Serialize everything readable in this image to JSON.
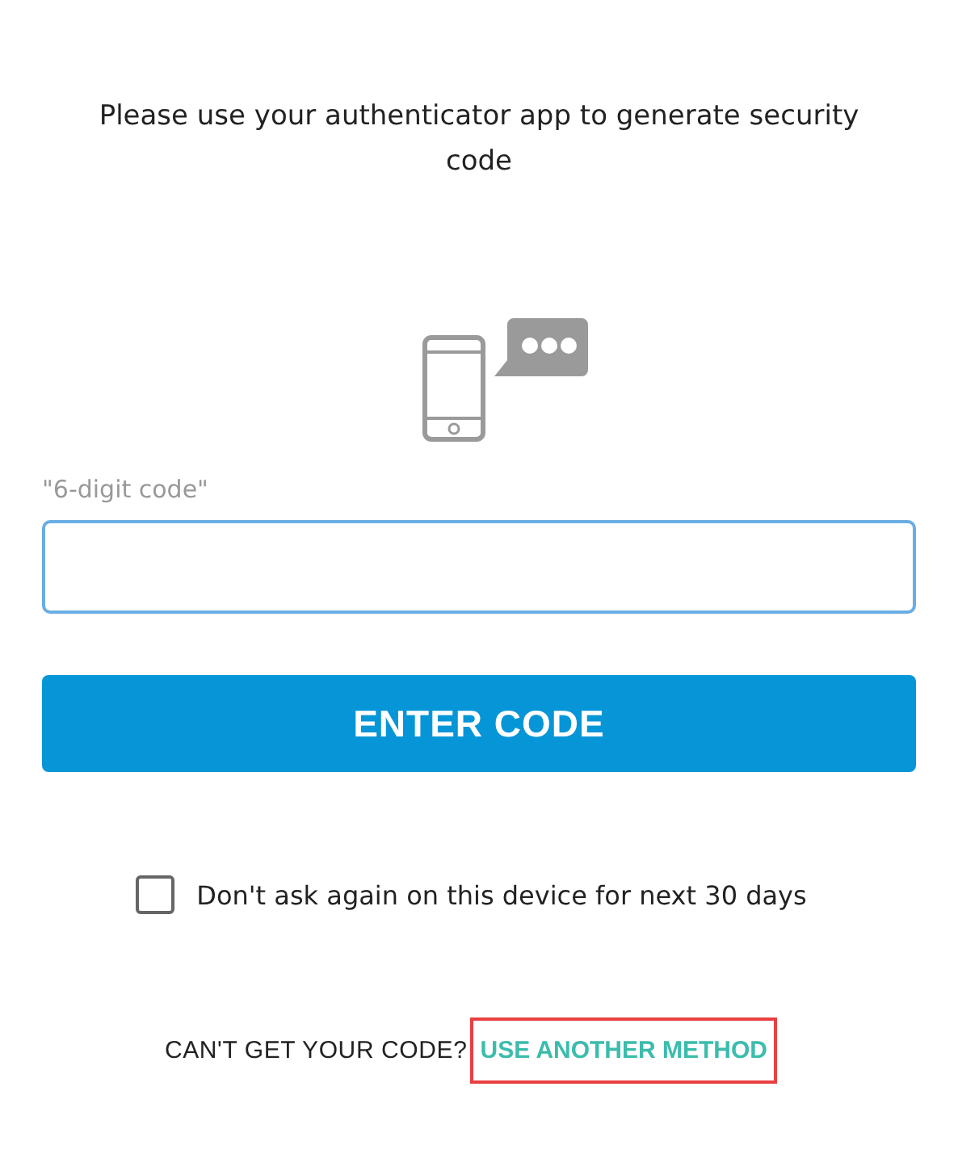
{
  "instructions": "Please use your authenticator app to generate security code",
  "code_field": {
    "label": "\"6-digit code\""
  },
  "submit_button": "ENTER CODE",
  "remember": {
    "label": "Don't ask again on this device for next 30 days",
    "checked": false
  },
  "footer": {
    "prompt": "CAN'T GET YOUR CODE?",
    "link": "USE ANOTHER METHOD",
    "highlighted": true
  }
}
